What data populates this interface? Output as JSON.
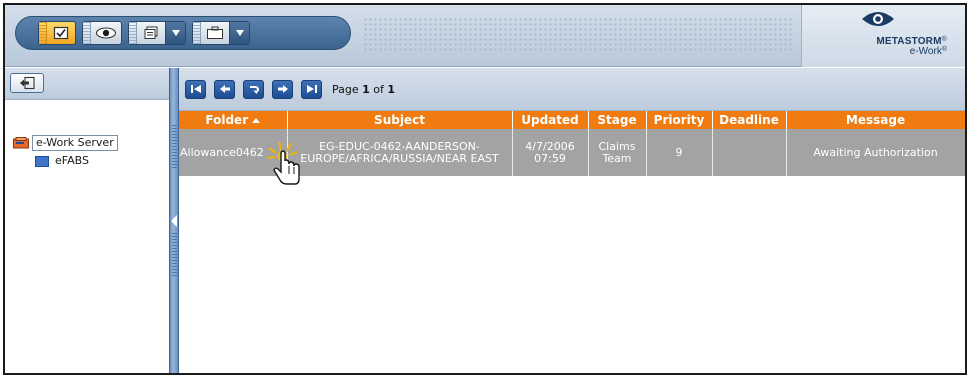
{
  "brand": {
    "name": "METASTORM",
    "sub": "e-Work",
    "registered": "®"
  },
  "toolbar": {
    "buttons": [
      {
        "name": "checklist-button",
        "icon": "checkbox-icon",
        "active": true
      },
      {
        "name": "view-button",
        "icon": "eye-icon",
        "active": false
      },
      {
        "name": "forms-button",
        "icon": "forms-icon",
        "active": false
      },
      {
        "name": "briefcase-button",
        "icon": "briefcase-icon",
        "active": false
      }
    ]
  },
  "tree": {
    "root_label": "e-Work Server",
    "child_label": "eFABS"
  },
  "pager": {
    "page_prefix": "Page",
    "current_page": "1",
    "of_label": "of",
    "total_pages": "1"
  },
  "grid": {
    "columns": [
      "Folder",
      "Subject",
      "Updated",
      "Stage",
      "Priority",
      "Deadline",
      "Message"
    ],
    "rows": [
      {
        "folder": "Allowance0462",
        "subject": "EG-EDUC-0462-AANDERSON-EUROPE/AFRICA/RUSSIA/NEAR EAST",
        "updated_date": "4/7/2006",
        "updated_time": "07:59",
        "stage": "Claims Team",
        "priority": "9",
        "deadline": "",
        "message": "Awaiting Authorization"
      }
    ]
  },
  "colors": {
    "header_orange": "#f07b10",
    "row_gray": "#a3a3a3",
    "toolbar_blue": "#3a638e",
    "active_yellow": "#f3a623"
  }
}
